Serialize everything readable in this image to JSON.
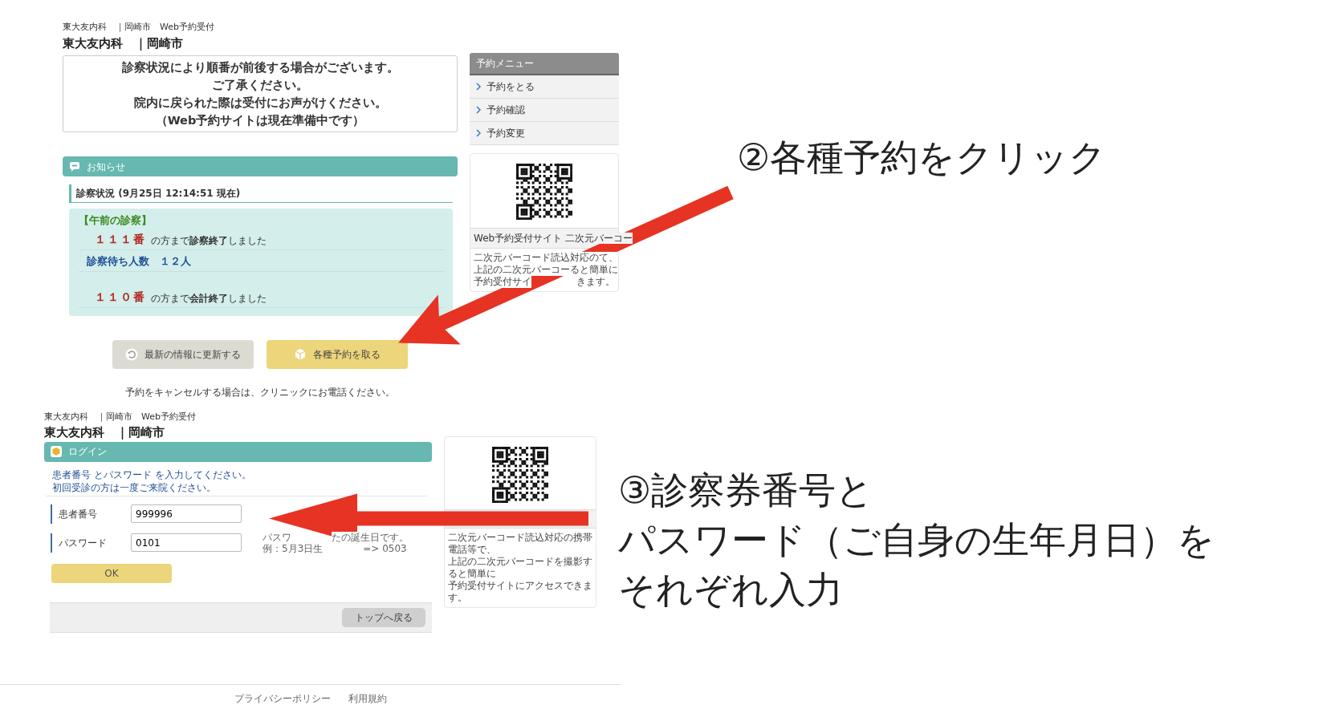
{
  "page1": {
    "breadcrumb": "東大友内科　｜岡崎市　Web予約受付",
    "title": "東大友内科　｜岡崎市",
    "notice": [
      "診察状況により順番が前後する場合がございます。",
      "ご了承ください。",
      "院内に戻られた際は受付にお声がけください。",
      "（Web予約サイトは現在準備中です）"
    ],
    "news_header": "お知らせ",
    "status_heading": "診察状況 (9月25日 12:14:51 現在)",
    "section": "【午前の診察】",
    "status_rows": [
      {
        "kind": "number",
        "number": "１１１番",
        "text": "の方まで**診察終了**しました"
      },
      {
        "kind": "count",
        "text": "診察待ち人数　１２人"
      },
      {
        "kind": "number",
        "number": "１１０番",
        "text": "の方まで**会計終了**しました"
      }
    ],
    "buttons": [
      {
        "kind": "refresh",
        "label": "最新の情報に更新する"
      },
      {
        "kind": "reserve",
        "label": "各種予約を取る"
      }
    ],
    "cancel_note": "予約をキャンセルする場合は、クリニックにお電話ください。",
    "menu": {
      "title": "予約メニュー",
      "items": [
        "予約をとる",
        "予約確認",
        "予約変更"
      ]
    },
    "qr_card": {
      "caption": "Web予約受付サイト 二次元バーコー",
      "description": [
        [
          "二次元バーコード読込対応の",
          "て、"
        ],
        [
          "上記の二次元バーコー",
          "ると簡単に"
        ],
        [
          "予約受付サイ",
          "きます。"
        ]
      ]
    }
  },
  "page2": {
    "breadcrumb": "東大友内科　｜岡崎市　Web予約受付",
    "title": "東大友内科　｜岡崎市",
    "login_header": "ログイン",
    "instructions": [
      "患者番号 とパスワード を入力してください。",
      "初回受診の方は一度ご来院ください。"
    ],
    "fields": [
      {
        "label": "患者番号",
        "value": "999996"
      },
      {
        "label": "パスワード",
        "value": "0101",
        "hint": [
          [
            "パスワ",
            "たの誕生日です。"
          ],
          [
            "例：5月3日生",
            "=> 0503"
          ]
        ]
      }
    ],
    "ok_button": "OK",
    "back_button": "トップへ戻る",
    "qr_card": {
      "description": [
        "二次元バーコード読込対応の携帯電話等で、",
        "上記の二次元バーコードを撮影すると簡単に",
        "予約受付サイトにアクセスできます。"
      ]
    }
  },
  "footer": [
    "プライバシーポリシー",
    "利用規約"
  ],
  "annotations": [
    {
      "lines": [
        "②各種予約をクリック"
      ]
    },
    {
      "lines": [
        "③診察券番号と",
        "パスワード（ご自身の生年月日）を",
        "それぞれ入力"
      ]
    }
  ]
}
